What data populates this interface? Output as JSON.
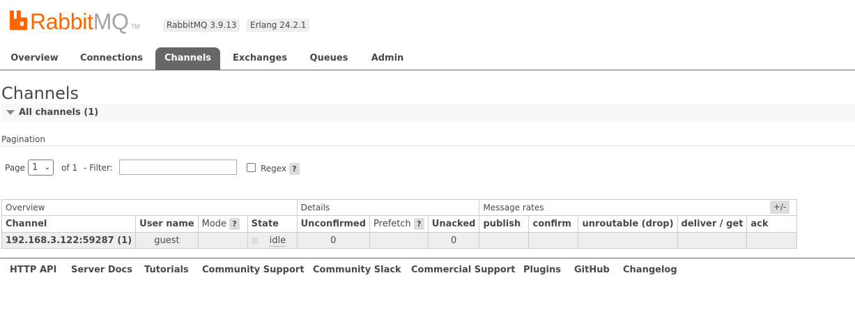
{
  "header": {
    "logo_part1": "Rabbit",
    "logo_part2": "MQ",
    "logo_tm": "TM",
    "rabbitmq_version": "RabbitMQ 3.9.13",
    "erlang_version": "Erlang 24.2.1",
    "brand_color": "#ff6600"
  },
  "tabs": [
    {
      "label": "Overview",
      "active": false
    },
    {
      "label": "Connections",
      "active": false
    },
    {
      "label": "Channels",
      "active": true
    },
    {
      "label": "Exchanges",
      "active": false
    },
    {
      "label": "Queues",
      "active": false
    },
    {
      "label": "Admin",
      "active": false
    }
  ],
  "page": {
    "title": "Channels",
    "section_header": "All channels (1)"
  },
  "pagination": {
    "label": "Pagination",
    "page_prefix": "Page",
    "page_selected": "1",
    "of_text": "of 1",
    "filter_label": "- Filter:",
    "filter_value": "",
    "regex_label": "Regex",
    "regex_checked": false,
    "help_label": "?"
  },
  "table": {
    "groups": [
      "Overview",
      "Details",
      "Message rates"
    ],
    "plus_minus": "+/-",
    "columns": [
      "Channel",
      "User name",
      "Mode",
      "State",
      "Unconfirmed",
      "Prefetch",
      "Unacked",
      "publish",
      "confirm",
      "unroutable (drop)",
      "deliver / get",
      "ack"
    ],
    "rows": [
      {
        "channel": "192.168.3.122:59287 (1)",
        "user_name": "guest",
        "mode": "",
        "state": "idle",
        "unconfirmed": "0",
        "prefetch": "",
        "unacked": "0",
        "publish": "",
        "confirm": "",
        "unroutable": "",
        "deliver_get": "",
        "ack": ""
      }
    ]
  },
  "footer": {
    "links": [
      "HTTP API",
      "Server Docs",
      "Tutorials",
      "Community Support",
      "Community Slack",
      "Commercial Support",
      "Plugins",
      "GitHub",
      "Changelog"
    ]
  }
}
